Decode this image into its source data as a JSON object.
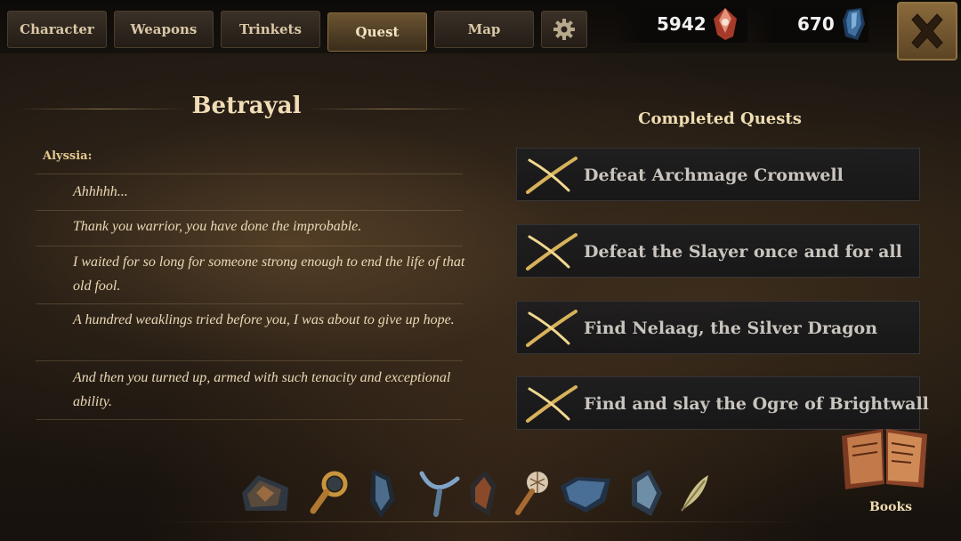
{
  "tabs": [
    {
      "label": "Character"
    },
    {
      "label": "Weapons"
    },
    {
      "label": "Trinkets"
    },
    {
      "label": "Quest",
      "active": true
    },
    {
      "label": "Map"
    }
  ],
  "currency": {
    "gold": {
      "value": "5942",
      "icon": "red-gem-icon"
    },
    "crystal": {
      "value": "670",
      "icon": "blue-crystal-icon"
    }
  },
  "quest": {
    "title": "Betrayal",
    "speaker": "Alyssia:",
    "lines": [
      "Ahhhhh...",
      "Thank you warrior, you have done the improbable.",
      "I waited for so long for someone strong enough to end the life of that old fool.",
      "A hundred weaklings tried before you, I was about to give up hope.",
      "And then you turned up, armed with such tenacity and exceptional ability."
    ]
  },
  "completed": {
    "title": "Completed Quests",
    "quests": [
      "Defeat Archmage Cromwell",
      "Defeat the Slayer once and for all",
      "Find Nelaag, the Silver Dragon",
      "Find and slay the Ogre of Brightwall"
    ]
  },
  "items": [
    "rock-shard-icon",
    "magnifying-glass-icon",
    "dark-shard-icon",
    "horn-icon",
    "ember-shard-icon",
    "web-wand-icon",
    "blue-rock-icon",
    "crystal-shard-icon",
    "feather-icon"
  ],
  "books": {
    "label": "Books"
  },
  "colors": {
    "accent": "#e4c98e",
    "active_tab": "#6a5331",
    "close": "#8a6a3c"
  }
}
